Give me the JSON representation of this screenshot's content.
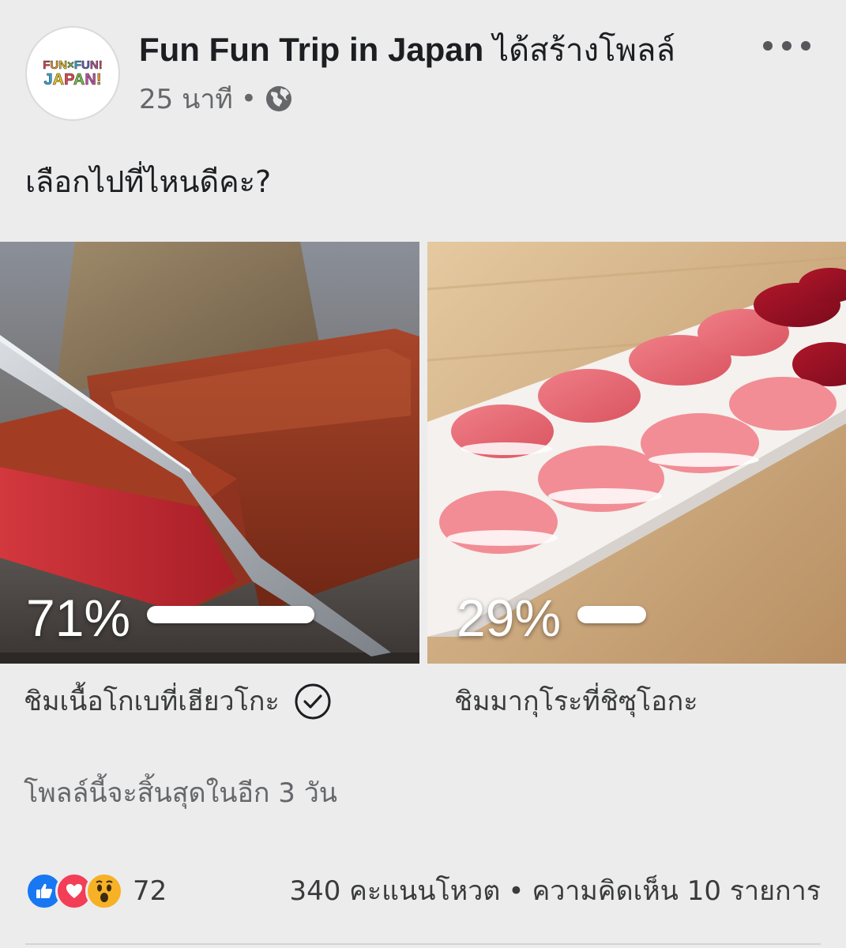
{
  "post": {
    "author": "Fun Fun Trip in Japan",
    "action": "ได้สร้างโพลล์",
    "time": "25 นาที",
    "separator": "•",
    "privacy_icon": "globe-icon",
    "more_icon": "more-dots-icon",
    "avatar_logo_top": "FUN×FUN!",
    "avatar_logo_bottom": "JAPAN!"
  },
  "poll": {
    "question": "เลือกไปที่ไหนดีคะ?",
    "options": [
      {
        "percent_label": "71%",
        "share": 0.71,
        "label": "ชิมเนื้อโกเบที่เฮียวโกะ",
        "selected": true,
        "image": "kobe-beef-steak"
      },
      {
        "percent_label": "29%",
        "share": 0.29,
        "label": "ชิมมากุโระที่ชิซุโอกะ",
        "selected": false,
        "image": "tuna-sushi-platter"
      }
    ],
    "ends": "โพลล์นี้จะสิ้นสุดในอีก 3 วัน"
  },
  "footer": {
    "reaction_icons": [
      "like-icon",
      "love-icon",
      "wow-icon"
    ],
    "reaction_count": "72",
    "votes": "340 คะแนนโหวต",
    "separator": "•",
    "comments": "ความคิดเห็น 10 รายการ"
  },
  "colors": {
    "background": "#ececec",
    "primary_text": "#1c1e21",
    "secondary_text": "#65676b",
    "like": "#1877f2",
    "love": "#f33e58",
    "wow": "#f7b125"
  }
}
